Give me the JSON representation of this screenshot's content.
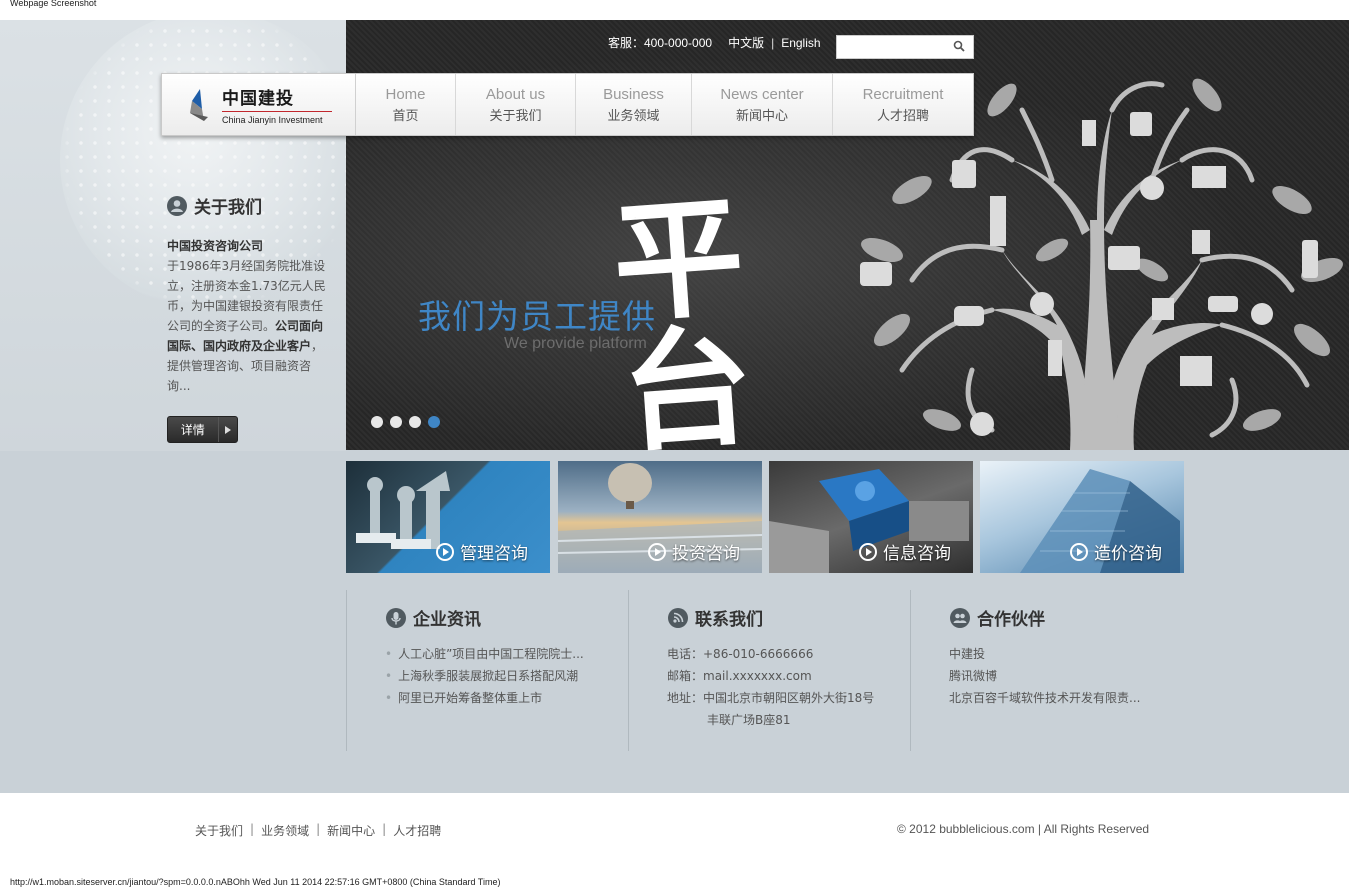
{
  "caption": "Webpage Screenshot",
  "topbar": {
    "service": "客服：400-000-000",
    "lang_cn": "中文版",
    "lang_en": "English",
    "search_placeholder": ""
  },
  "logo": {
    "cn": "中国建投",
    "en": "China Jianyin Investment"
  },
  "nav": [
    {
      "en": "Home",
      "cn": "首页"
    },
    {
      "en": "About us",
      "cn": "关于我们"
    },
    {
      "en": "Business",
      "cn": "业务领域"
    },
    {
      "en": "News center",
      "cn": "新闻中心"
    },
    {
      "en": "Recruitment",
      "cn": "人才招聘"
    }
  ],
  "hero": {
    "cn": "我们为员工提供",
    "en": "We provide platform",
    "big": "平台",
    "active_slide": 4,
    "slides": 4
  },
  "about": {
    "title": "关于我们",
    "company": "中国投资咨询公司",
    "text1": "于1986年3月经国务院批准设立，注册资本金1.73亿元人民币，为中国建银投资有限责任公司的全资子公司。",
    "text_bold": "公司面向国际、国内政府及企业客户",
    "text2": "，提供管理咨询、项目融资咨询...",
    "button": "详情"
  },
  "tiles": [
    {
      "label": "管理咨询"
    },
    {
      "label": "投资咨询"
    },
    {
      "label": "信息咨询"
    },
    {
      "label": "造价咨询"
    }
  ],
  "news": {
    "title": "企业资讯",
    "items": [
      "人工心脏”项目由中国工程院院士...",
      "上海秋季服装展掀起日系搭配风潮",
      "阿里已开始筹备整体重上市"
    ]
  },
  "contact": {
    "title": "联系我们",
    "phone": "电话：+86-010-6666666",
    "email": "邮箱：mail.xxxxxxx.com",
    "address": "地址：中国北京市朝阳区朝外大街18号",
    "address2": "丰联广场B座81"
  },
  "partners": {
    "title": "合作伙伴",
    "items": [
      "中建投",
      "腾讯微博",
      "北京百容千域软件技术开发有限责..."
    ]
  },
  "footer": {
    "links": [
      "关于我们",
      "业务领域",
      "新闻中心",
      "人才招聘"
    ],
    "copyright": "© 2012 bubblelicious.com | All Rights Reserved"
  },
  "status_url": "http://w1.moban.siteserver.cn/jiantou/?spm=0.0.0.0.nABOhh Wed Jun 11 2014 22:57:16 GMT+0800 (China Standard Time)",
  "colors": {
    "accent": "#3f86c6",
    "page_bg": "#c9d1d7",
    "hero_bg": "#2b2b2b"
  }
}
